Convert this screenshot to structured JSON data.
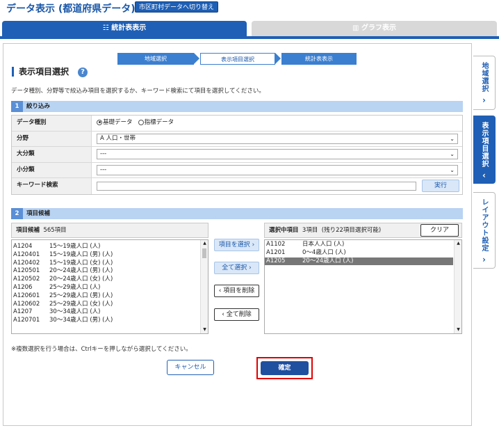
{
  "header": {
    "title": "データ表示 (都道府県データ)",
    "switch_label": "市区町村データへ切り替え"
  },
  "main_tabs": {
    "table": "統計表表示",
    "graph": "グラフ表示",
    "table_icon": "table-icon",
    "graph_icon": "bar-chart-icon"
  },
  "side_tabs": [
    {
      "label": "地域選択",
      "chevron": "›"
    },
    {
      "label": "表示項目選択",
      "chevron": "‹"
    },
    {
      "label": "レイアウト設定",
      "chevron": "›"
    }
  ],
  "steps": [
    "地域選択",
    "表示項目選択",
    "統計表表示"
  ],
  "section": {
    "title": "表示項目選択",
    "help": "?",
    "instruction": "データ種別、分野等で絞込み項目を選択するか、キーワード検索にて項目を選択してください。"
  },
  "filter": {
    "num": "1",
    "heading": "絞り込み",
    "data_type_label": "データ種別",
    "data_type_options": [
      "基礎データ",
      "指標データ"
    ],
    "field_label": "分野",
    "field_value": "A 人口・世帯",
    "major_label": "大分類",
    "major_value": "---",
    "minor_label": "小分類",
    "minor_value": "---",
    "keyword_label": "キーワード検索",
    "keyword_value": "",
    "exec_label": "実行"
  },
  "candidates": {
    "num": "2",
    "heading": "項目候補",
    "list_label": "項目候補",
    "count": "565項目",
    "items": [
      {
        "code": "A1204",
        "name": "15～19歳人口 (人)"
      },
      {
        "code": "A120401",
        "name": "15～19歳人口 (男) (人)"
      },
      {
        "code": "A120402",
        "name": "15～19歳人口 (女) (人)"
      },
      {
        "code": "A120501",
        "name": "20～24歳人口 (男) (人)"
      },
      {
        "code": "A120502",
        "name": "20～24歳人口 (女) (人)"
      },
      {
        "code": "A1206",
        "name": "25～29歳人口 (人)"
      },
      {
        "code": "A120601",
        "name": "25～29歳人口 (男) (人)"
      },
      {
        "code": "A120602",
        "name": "25～29歳人口 (女) (人)"
      },
      {
        "code": "A1207",
        "name": "30～34歳人口 (人)"
      },
      {
        "code": "A120701",
        "name": "30～34歳人口 (男) (人)"
      }
    ]
  },
  "selected": {
    "list_label": "選択中項目",
    "count": "3項目",
    "remaining": "(残り22項目選択可能)",
    "clear_label": "クリア",
    "items": [
      {
        "code": "A1102",
        "name": "日本人人口 (人)",
        "highlighted": false
      },
      {
        "code": "A1201",
        "name": "0～4歳人口 (人)",
        "highlighted": false
      },
      {
        "code": "A1205",
        "name": "20～24歳人口 (人)",
        "highlighted": true
      }
    ]
  },
  "controls": {
    "select_item": "項目を選択",
    "select_all": "全て選択",
    "remove_item": "項目を削除",
    "remove_all": "全て削除"
  },
  "note": "※複数選択を行う場合は、Ctrlキーを押しながら選択してください。",
  "footer": {
    "cancel": "キャンセル",
    "confirm": "確定"
  },
  "colors": {
    "primary": "#1f5fb5",
    "highlight_border": "#e00000"
  }
}
